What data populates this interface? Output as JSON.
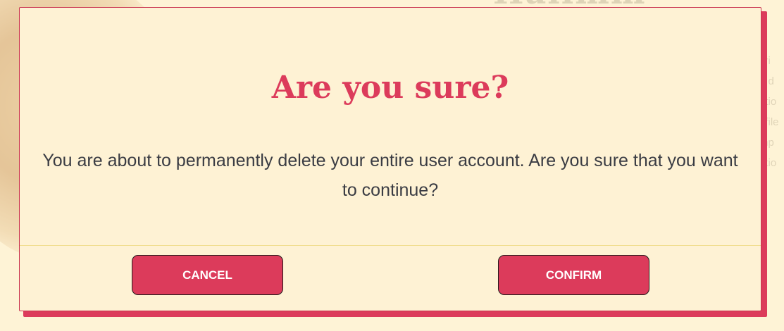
{
  "background": {
    "heading_partial": "Hallmm",
    "list_fragments": [
      "cri",
      "e d",
      "otio",
      "ofile",
      "mp",
      "otio"
    ]
  },
  "dialog": {
    "title": "Are you sure?",
    "message": "You are about to permanently delete your entire user account. Are you sure that you want to continue?",
    "cancel_label": "CANCEL",
    "confirm_label": "CONFIRM"
  },
  "colors": {
    "accent": "#dc3b5b",
    "dialog_background": "#fef2d4",
    "text": "#3a3c43",
    "divider": "#f0dc8a"
  }
}
